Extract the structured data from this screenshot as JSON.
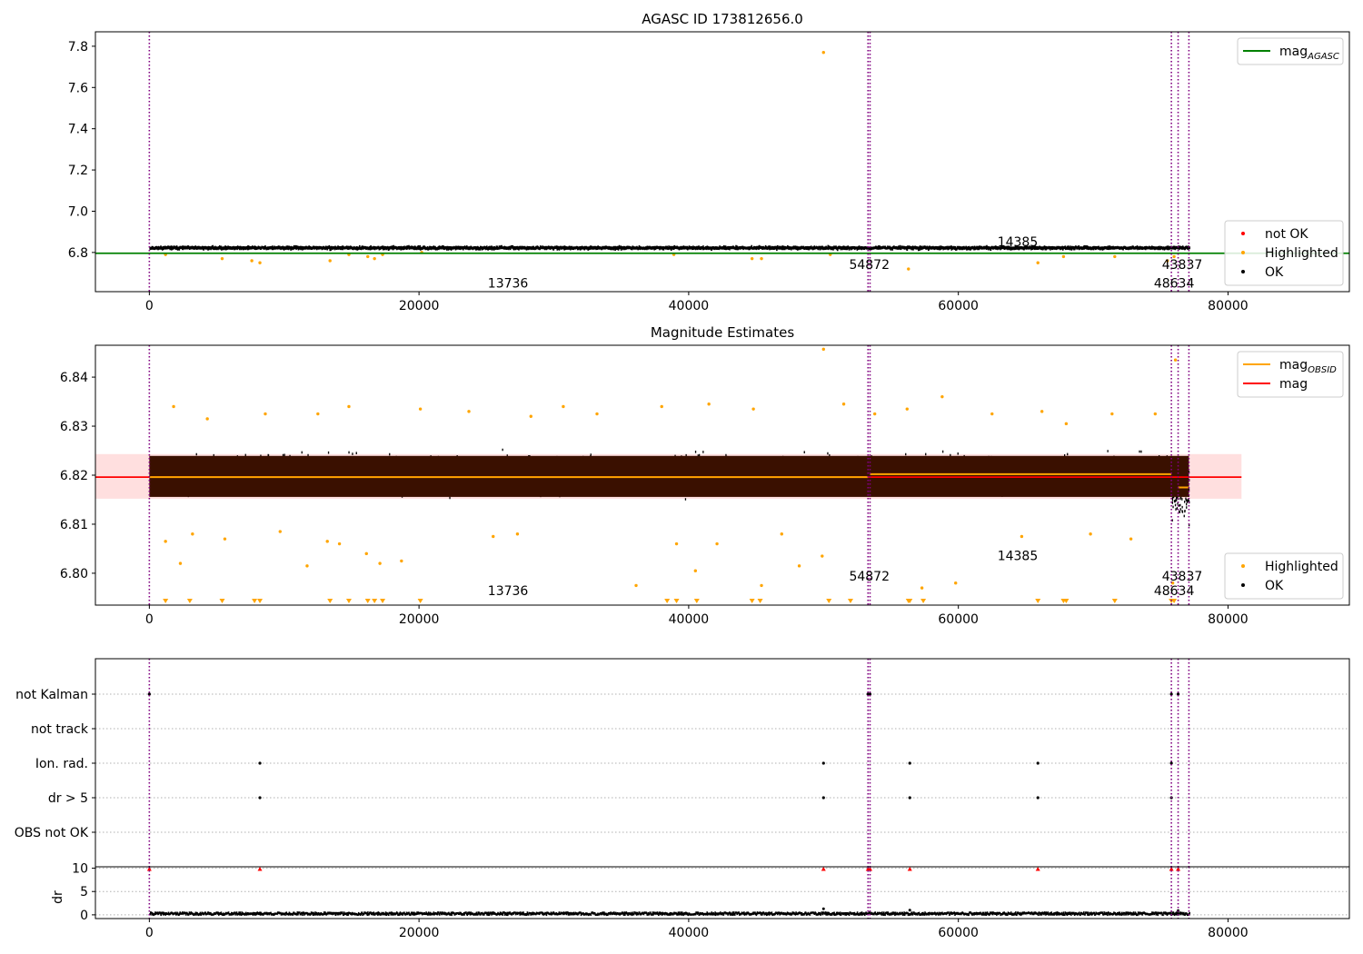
{
  "figure": {
    "panel1_title": "AGASC ID 173812656.0",
    "panel2_title": "Magnitude Estimates"
  },
  "colors": {
    "ok": "#000000",
    "highlighted": "#ffa500",
    "not_ok": "#ff0000",
    "agasc_line": "#008000",
    "obsid_line": "#ffa500",
    "mag_line": "#ff0000",
    "band": "#ffc0c0",
    "band_dark": "#3a1000",
    "vline": "#800080",
    "grid": "#b0b0b0"
  },
  "chart_data": [
    {
      "type": "scatter",
      "title": "AGASC ID 173812656.0",
      "xlim": [
        -4000,
        89000
      ],
      "ylim": [
        6.61,
        7.87
      ],
      "xticks": [
        0,
        20000,
        40000,
        60000,
        80000
      ],
      "xtick_labels": [
        "0",
        "20000",
        "40000",
        "60000",
        "80000"
      ],
      "yticks": [
        6.8,
        7.0,
        7.2,
        7.4,
        7.6,
        7.8
      ],
      "ytick_labels": [
        "6.8",
        "7.0",
        "7.2",
        "7.4",
        "7.6",
        "7.8"
      ],
      "legend_upper": {
        "position": "top-right",
        "entries": [
          {
            "label": "mag",
            "sub": "AGASC",
            "color": "#008000",
            "style": "line"
          }
        ]
      },
      "legend_lower": {
        "position": "bottom-right",
        "entries": [
          {
            "label": "not OK",
            "color": "#ff0000",
            "style": "marker"
          },
          {
            "label": "Highlighted",
            "color": "#ffa500",
            "style": "marker"
          },
          {
            "label": "OK",
            "color": "#000000",
            "style": "marker"
          }
        ]
      },
      "agasc_mag": 6.796,
      "ok_band": {
        "x_start": 0,
        "x_end": 77100,
        "center": 6.822,
        "spread": 0.011
      },
      "highlighted_points": [
        [
          1200,
          6.79
        ],
        [
          5400,
          6.77
        ],
        [
          7600,
          6.76
        ],
        [
          8200,
          6.75
        ],
        [
          13400,
          6.76
        ],
        [
          14800,
          6.79
        ],
        [
          16200,
          6.78
        ],
        [
          16700,
          6.77
        ],
        [
          17300,
          6.79
        ],
        [
          20200,
          6.8
        ],
        [
          38900,
          6.79
        ],
        [
          44700,
          6.77
        ],
        [
          45400,
          6.77
        ],
        [
          50000,
          7.77
        ],
        [
          50500,
          6.79
        ],
        [
          56300,
          6.72
        ],
        [
          65900,
          6.75
        ],
        [
          67800,
          6.78
        ],
        [
          71600,
          6.78
        ],
        [
          75500,
          6.76
        ],
        [
          76000,
          6.78
        ]
      ],
      "obsid_labels": [
        {
          "text": "13736",
          "x": 26600,
          "y": 6.63
        },
        {
          "text": "54872",
          "x": 53400,
          "y": 6.72
        },
        {
          "text": "14385",
          "x": 64400,
          "y": 6.83
        },
        {
          "text": "43837",
          "x": 76600,
          "y": 6.72
        },
        {
          "text": "48634",
          "x": 76000,
          "y": 6.63
        }
      ],
      "vlines": [
        0,
        53300,
        53450,
        75800,
        76300,
        77100
      ]
    },
    {
      "type": "scatter",
      "title": "Magnitude Estimates",
      "xlim": [
        -4000,
        89000
      ],
      "ylim": [
        6.7935,
        6.8465
      ],
      "xticks": [
        0,
        20000,
        40000,
        60000,
        80000
      ],
      "xtick_labels": [
        "0",
        "20000",
        "40000",
        "60000",
        "80000"
      ],
      "yticks": [
        6.8,
        6.81,
        6.82,
        6.83,
        6.84
      ],
      "ytick_labels": [
        "6.80",
        "6.81",
        "6.82",
        "6.83",
        "6.84"
      ],
      "legend_upper": {
        "position": "top-right",
        "entries": [
          {
            "label": "mag",
            "sub": "OBSID",
            "color": "#ffa500",
            "style": "line"
          },
          {
            "label": "mag",
            "sub": "",
            "color": "#ff0000",
            "style": "line"
          }
        ]
      },
      "legend_lower": {
        "position": "bottom-right",
        "entries": [
          {
            "label": "Highlighted",
            "color": "#ffa500",
            "style": "marker"
          },
          {
            "label": "OK",
            "color": "#000000",
            "style": "marker"
          }
        ]
      },
      "mag": 6.8196,
      "mag_band": [
        6.8152,
        6.8243
      ],
      "mag_band_xlim": [
        -4000,
        81000
      ],
      "obsid_mags": [
        {
          "x0": 0,
          "x1": 53300,
          "y": 6.8196
        },
        {
          "x0": 53450,
          "x1": 75800,
          "y": 6.8202
        },
        {
          "x0": 76300,
          "x1": 77100,
          "y": 6.8175
        }
      ],
      "ok_band": {
        "x_start": 0,
        "x_end": 77100,
        "center": 6.82,
        "spread": 0.0062
      },
      "highlighted_points": [
        [
          1200,
          6.8065
        ],
        [
          1800,
          6.834
        ],
        [
          2300,
          6.802
        ],
        [
          3200,
          6.808
        ],
        [
          4300,
          6.8315
        ],
        [
          5600,
          6.807
        ],
        [
          8600,
          6.8325
        ],
        [
          9700,
          6.8085
        ],
        [
          11700,
          6.8015
        ],
        [
          12500,
          6.8325
        ],
        [
          13200,
          6.8065
        ],
        [
          14100,
          6.806
        ],
        [
          14800,
          6.834
        ],
        [
          16100,
          6.804
        ],
        [
          17100,
          6.802
        ],
        [
          18700,
          6.8025
        ],
        [
          20100,
          6.8335
        ],
        [
          23700,
          6.833
        ],
        [
          25500,
          6.8075
        ],
        [
          27300,
          6.808
        ],
        [
          28300,
          6.832
        ],
        [
          30700,
          6.834
        ],
        [
          33200,
          6.8325
        ],
        [
          36100,
          6.7975
        ],
        [
          38000,
          6.834
        ],
        [
          39100,
          6.806
        ],
        [
          40500,
          6.8005
        ],
        [
          41500,
          6.8345
        ],
        [
          42100,
          6.806
        ],
        [
          44800,
          6.8335
        ],
        [
          45400,
          6.7975
        ],
        [
          46900,
          6.808
        ],
        [
          48200,
          6.8015
        ],
        [
          49900,
          6.8035
        ],
        [
          50000,
          6.8457
        ],
        [
          51500,
          6.8345
        ],
        [
          53800,
          6.8325
        ],
        [
          56200,
          6.8335
        ],
        [
          57300,
          6.797
        ],
        [
          58800,
          6.836
        ],
        [
          59800,
          6.798
        ],
        [
          62500,
          6.8325
        ],
        [
          64700,
          6.8075
        ],
        [
          66200,
          6.833
        ],
        [
          68000,
          6.8305
        ],
        [
          69800,
          6.808
        ],
        [
          71400,
          6.8325
        ],
        [
          72800,
          6.807
        ],
        [
          74600,
          6.8325
        ],
        [
          75900,
          6.798
        ],
        [
          76100,
          6.8435
        ]
      ],
      "lower_markers": [
        1200,
        3000,
        5400,
        7800,
        8200,
        13400,
        14800,
        16200,
        16700,
        17300,
        20100,
        38400,
        39100,
        40600,
        44700,
        45300,
        50400,
        52000,
        56300,
        56400,
        57400,
        65900,
        67800,
        68000,
        71600,
        75800,
        76000
      ],
      "obsid_labels": [
        {
          "text": "13736",
          "x": 26600,
          "y": 6.7955
        },
        {
          "text": "54872",
          "x": 53400,
          "y": 6.7985
        },
        {
          "text": "14385",
          "x": 64400,
          "y": 6.8027
        },
        {
          "text": "43837",
          "x": 76600,
          "y": 6.7985
        },
        {
          "text": "48634",
          "x": 76000,
          "y": 6.7955
        }
      ],
      "vlines": [
        0,
        53300,
        53450,
        75800,
        76300,
        77100
      ]
    },
    {
      "type": "scatter",
      "title": "",
      "xlim": [
        -4000,
        89000
      ],
      "category_ylabels": [
        "not Kalman",
        "not track",
        "Ion. rad.",
        "dr > 5",
        "OBS not OK"
      ],
      "flag_points": {
        "not Kalman": [
          0,
          53300,
          53450,
          75800,
          76300
        ],
        "not track": [],
        "Ion. rad.": [
          8200,
          50000,
          56400,
          65900,
          75800
        ],
        "dr > 5": [
          8200,
          50000,
          56400,
          65900,
          75800
        ],
        "OBS not OK": []
      },
      "vlines": [
        0,
        53300,
        53450,
        75800,
        76300,
        77100
      ]
    },
    {
      "type": "scatter",
      "title": "",
      "ylabel": "dr",
      "xlim": [
        -4000,
        89000
      ],
      "ylim": [
        -0.8,
        10.3
      ],
      "xticks": [
        0,
        20000,
        40000,
        60000,
        80000
      ],
      "xtick_labels": [
        "0",
        "20000",
        "40000",
        "60000",
        "80000"
      ],
      "yticks": [
        0,
        5,
        10
      ],
      "ytick_labels": [
        "0",
        "5",
        "10"
      ],
      "dr_points_baseline_max": 0.5,
      "dr_spikes": [
        [
          50000,
          1.3
        ],
        [
          56400,
          1.0
        ],
        [
          76300,
          0.9
        ]
      ],
      "capped_markers": [
        0,
        8200,
        50000,
        53300,
        53450,
        56400,
        65900,
        75800,
        76300
      ],
      "vlines": [
        0,
        53300,
        53450,
        75800,
        76300,
        77100
      ]
    }
  ]
}
